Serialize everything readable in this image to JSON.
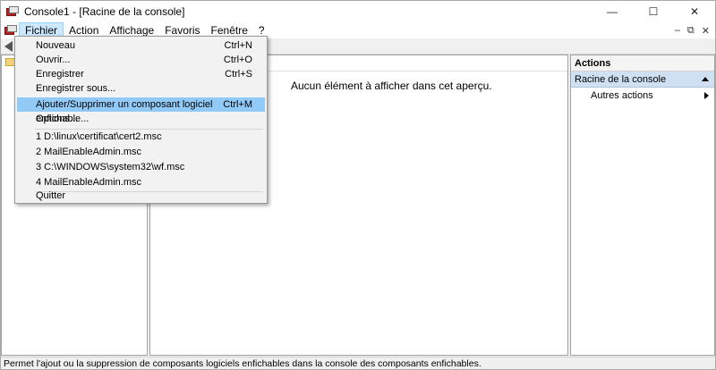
{
  "window": {
    "title": "Console1 - [Racine de la console]",
    "controls": [
      "—",
      "☐",
      "✕"
    ]
  },
  "menubar": {
    "items": [
      "Fichier",
      "Action",
      "Affichage",
      "Favoris",
      "Fenêtre",
      "?"
    ],
    "mdi_controls": [
      "–",
      "⧉",
      "✕"
    ]
  },
  "file_menu": {
    "items": [
      {
        "label": "Nouveau",
        "shortcut": "Ctrl+N"
      },
      {
        "label": "Ouvrir...",
        "shortcut": "Ctrl+O"
      },
      {
        "label": "Enregistrer",
        "shortcut": "Ctrl+S"
      },
      {
        "label": "Enregistrer sous...",
        "shortcut": ""
      },
      {
        "label": "Ajouter/Supprimer un composant logiciel enfichable...",
        "shortcut": "Ctrl+M"
      },
      {
        "label": "Options...",
        "shortcut": ""
      },
      {
        "label": "1 D:\\linux\\certificat\\cert2.msc",
        "shortcut": ""
      },
      {
        "label": "2 MailEnableAdmin.msc",
        "shortcut": ""
      },
      {
        "label": "3 C:\\WINDOWS\\system32\\wf.msc",
        "shortcut": ""
      },
      {
        "label": "4 MailEnableAdmin.msc",
        "shortcut": ""
      },
      {
        "label": "Quitter",
        "shortcut": ""
      }
    ],
    "highlighted_index": 4
  },
  "center": {
    "empty_message": "Aucun élément à afficher dans cet aperçu."
  },
  "actions_pane": {
    "header": "Actions",
    "section": "Racine de la console",
    "items": [
      "Autres actions"
    ]
  },
  "statusbar": {
    "text": "Permet l'ajout ou la suppression de composants logiciels enfichables dans la console des composants enfichables."
  },
  "colors": {
    "menu_highlight": "#91c9f7",
    "active_menu": "#cce8ff",
    "actions_section_bg": "#cfe0f3"
  }
}
